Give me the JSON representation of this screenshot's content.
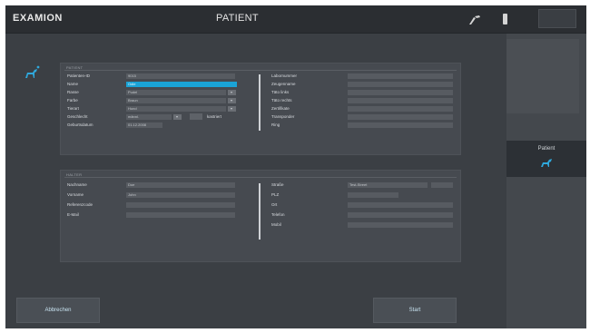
{
  "app": {
    "logo": "EXAMION",
    "title": "PATIENT"
  },
  "sidebar": {
    "items": [
      {
        "label": "Patient",
        "icon": "dog-icon"
      }
    ]
  },
  "patient_section": {
    "heading": "PATIENT",
    "left_fields": [
      {
        "label": "Patienten-ID",
        "value": "9015"
      },
      {
        "label": "Name",
        "value": "Odie"
      },
      {
        "label": "Rasse",
        "value": "Pudel"
      },
      {
        "label": "Farbe",
        "value": "Braun"
      },
      {
        "label": "Tierart",
        "value": "Hund"
      },
      {
        "label": "Geschlecht",
        "value": "männl."
      },
      {
        "label": "Geburtsdatum",
        "value": "01.12.2008"
      }
    ],
    "kastriert_label": "kastriert",
    "right_fields": [
      {
        "label": "Labornummer",
        "value": ""
      },
      {
        "label": "Zeugenname",
        "value": ""
      },
      {
        "label": "Täto links",
        "value": ""
      },
      {
        "label": "Täto rechts",
        "value": ""
      },
      {
        "label": "Zertifikate",
        "value": ""
      },
      {
        "label": "Transponder",
        "value": ""
      },
      {
        "label": "Ring",
        "value": ""
      }
    ]
  },
  "owner_section": {
    "heading": "HALTER",
    "left_fields": [
      {
        "label": "Nachname",
        "value": "Doe"
      },
      {
        "label": "Vorname",
        "value": "John"
      },
      {
        "label": "Referenzcode",
        "value": ""
      },
      {
        "label": "E-Mail",
        "value": ""
      }
    ],
    "right_fields": [
      {
        "label": "Straße",
        "value": "Test-Street"
      },
      {
        "label": "PLZ",
        "value": ""
      },
      {
        "label": "Ort",
        "value": ""
      },
      {
        "label": "Telefon",
        "value": ""
      },
      {
        "label": "Mobil",
        "value": ""
      }
    ]
  },
  "buttons": {
    "cancel": "Abbrechen",
    "start": "Start"
  },
  "colors": {
    "accent": "#1aa3d6",
    "background": "#3b3f44"
  }
}
